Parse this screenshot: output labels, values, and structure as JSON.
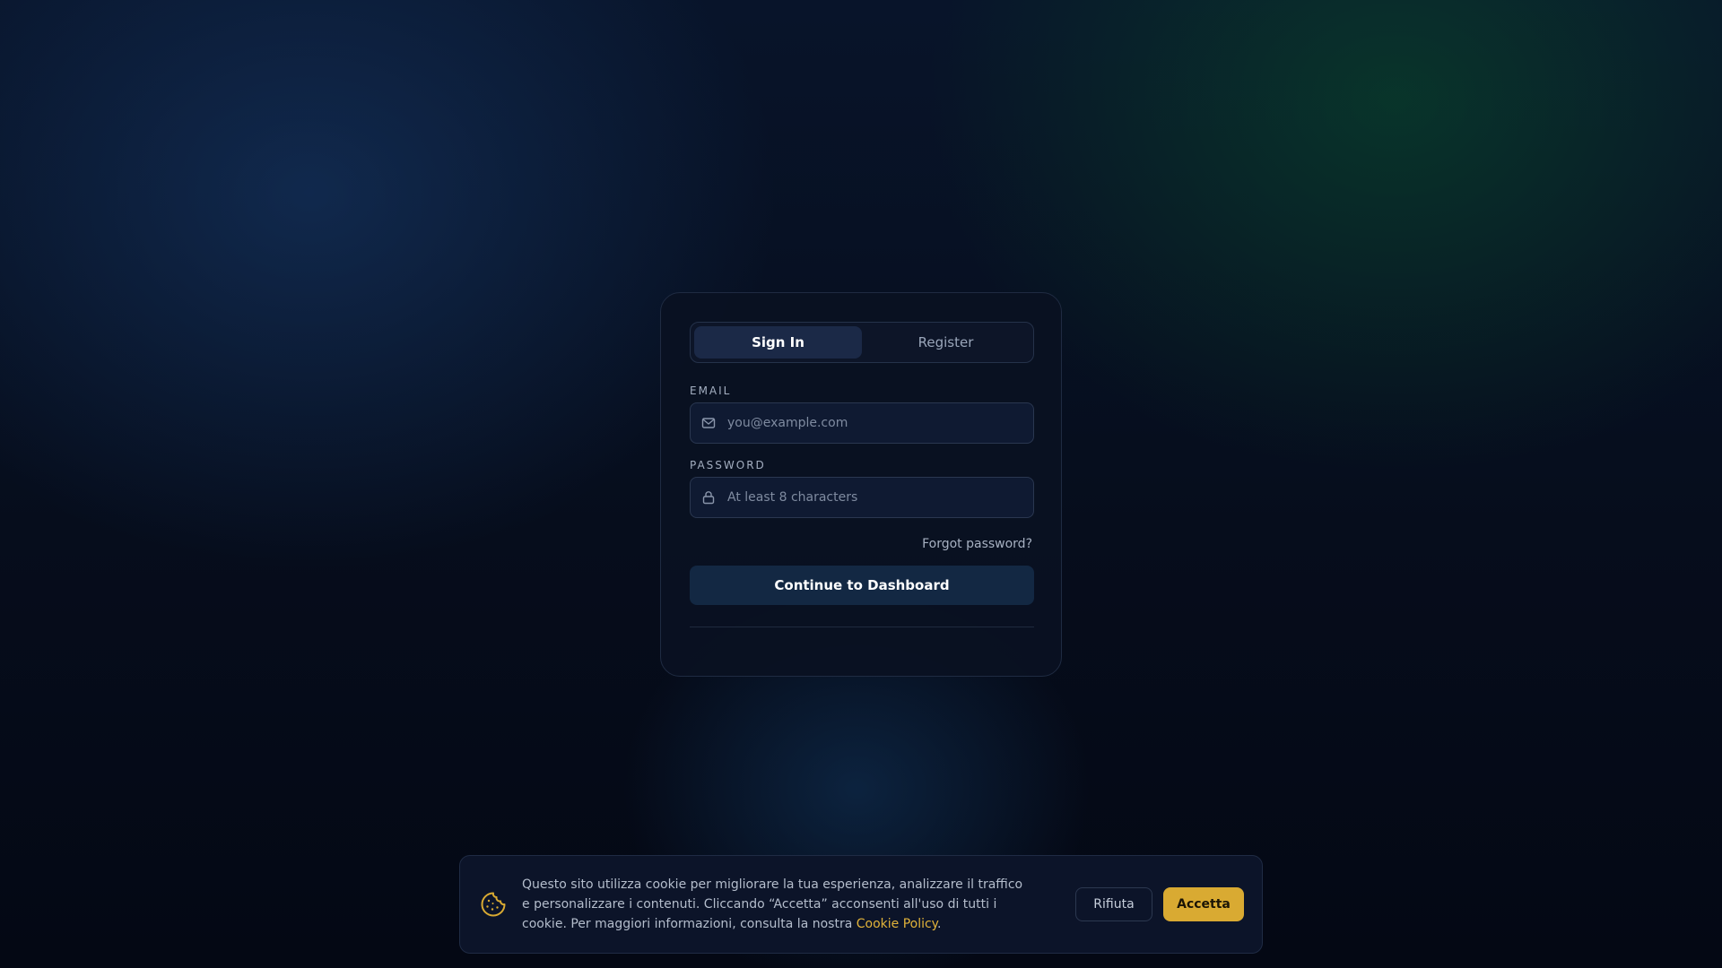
{
  "colors": {
    "background": "#050a16",
    "card": "#0a1122",
    "accent": "#d9aa32",
    "primary_button": "#132843",
    "active_tab": "#1b2947"
  },
  "auth": {
    "tabs": [
      {
        "label": "Sign In",
        "active": true
      },
      {
        "label": "Register",
        "active": false
      }
    ],
    "email": {
      "label": "EMAIL",
      "placeholder": "you@example.com",
      "value": "",
      "icon": "mail-icon"
    },
    "password": {
      "label": "PASSWORD",
      "placeholder": "At least 8 characters",
      "value": "",
      "icon": "lock-icon"
    },
    "forgot_label": "Forgot password?",
    "submit_label": "Continue to Dashboard"
  },
  "cookie_banner": {
    "icon": "cookie-icon",
    "text_before_link": "Questo sito utilizza cookie per migliorare la tua esperienza, analizzare il traffico e personalizzare i contenuti. Cliccando “Accetta” acconsenti all'uso di tutti i cookie. Per maggiori informazioni, consulta la nostra ",
    "link_label": "Cookie Policy",
    "text_after_link": ".",
    "reject_label": "Rifiuta",
    "accept_label": "Accetta"
  }
}
